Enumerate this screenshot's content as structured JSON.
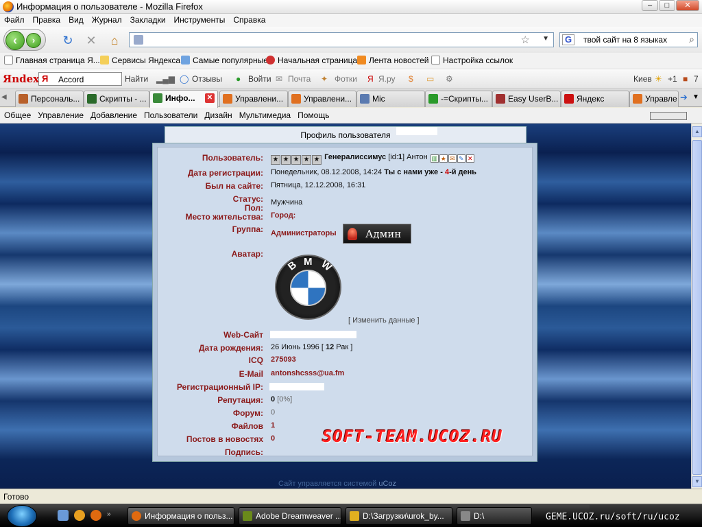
{
  "window": {
    "title": "Информация о пользователе - Mozilla Firefox"
  },
  "menubar": [
    "Файл",
    "Правка",
    "Вид",
    "Журнал",
    "Закладки",
    "Инструменты",
    "Справка"
  ],
  "nav": {
    "search_text": "твой сайт на 8 языках",
    "search_engine_icon": "G"
  },
  "bookmarks": [
    "Главная страница Я...",
    "Сервисы Яндекса",
    "Самые популярные",
    "Начальная страница",
    "Лента новостей",
    "Настройка ссылок"
  ],
  "yandex_bar": {
    "logo": "Яndex",
    "search_value": "Accord",
    "find": "Найти",
    "reviews": "Отзывы",
    "login": "Войти",
    "mail": "Почта",
    "photos": "Фотки",
    "yaru": "Я.ру",
    "city": "Киев",
    "temp": "+1",
    "count": "7"
  },
  "tabs": [
    {
      "label": "Персональ...",
      "color": "#b8602a"
    },
    {
      "label": "Скрипты - ...",
      "color": "#2a6a2a"
    },
    {
      "label": "Инфо...",
      "color": "#3a8a3a",
      "active": true
    },
    {
      "label": "Управлени...",
      "color": "#e07020"
    },
    {
      "label": "Управлени...",
      "color": "#e07020"
    },
    {
      "label": "Mic",
      "color": "#5a7ab0"
    },
    {
      "label": "-=Скрипты...",
      "color": "#2a9a2a"
    },
    {
      "label": "Easy UserB...",
      "color": "#a03030"
    },
    {
      "label": "Яндекс",
      "color": "#cc1111"
    },
    {
      "label": "Управле",
      "color": "#e07020"
    }
  ],
  "site_menu": [
    "Общее",
    "Управление",
    "Добавление",
    "Пользователи",
    "Дизайн",
    "Мультимедиа",
    "Помощь"
  ],
  "profile": {
    "header": "Профиль пользователя",
    "labels": {
      "user": "Пользователь:",
      "reg_date": "Дата регистрации:",
      "last_seen": "Был на сайте:",
      "status": "Статус:",
      "gender": "Пол:",
      "residence": "Место жительства:",
      "group": "Группа:",
      "avatar": "Аватар:",
      "website": "Web-Сайт",
      "birth": "Дата рождения:",
      "icq": "ICQ",
      "email": "E-Mail",
      "reg_ip": "Регистрационный IP:",
      "reputation": "Репутация:",
      "forum": "Форум:",
      "files": "Файлов",
      "news_posts": "Постов в новостях",
      "signature": "Подпись:"
    },
    "values": {
      "rank": "Генералиссимус",
      "id_prefix": "[id:",
      "id": "1",
      "id_suffix": "]",
      "name": "Антон",
      "reg_date": "Понедельник, 08.12.2008, 14:24",
      "with_us": "Ты с нами уже -",
      "days_num": "4",
      "days_suffix": "-й день",
      "last_seen": "Пятница, 12.12.2008, 16:31",
      "gender": "Мужчина",
      "city_label": "Город:",
      "group": "Администраторы",
      "badge": "Админ",
      "edit_link": "[ Изменить данные ]",
      "birth": "26 Июнь 1996 [",
      "age": "12",
      "zodiac": "Рак ]",
      "icq": "275093",
      "email": "antonshcsss@ua.fm",
      "reputation": "0",
      "reputation_pct": "[0%]",
      "forum": "0",
      "files": "1",
      "news_posts": "0"
    },
    "avatar_letters": [
      "B",
      "M",
      "W"
    ]
  },
  "watermark": "SOFT-TEAM.UCOZ.RU",
  "footer": {
    "text": "Сайт управляется системой",
    "brand": "uCoz"
  },
  "status_text": "Готово",
  "taskbar": {
    "items": [
      {
        "label": "Информация о польз...",
        "color": "#e06a10"
      },
      {
        "label": "Adobe Dreamweaver ...",
        "color": "#6a8a1a"
      },
      {
        "label": "D:\\Загрузки\\urok_by...",
        "color": "#e0b020"
      },
      {
        "label": "D:\\",
        "color": "#888"
      }
    ],
    "overlay": "GEME.UCOZ.ru/soft/ru/ucoz"
  }
}
